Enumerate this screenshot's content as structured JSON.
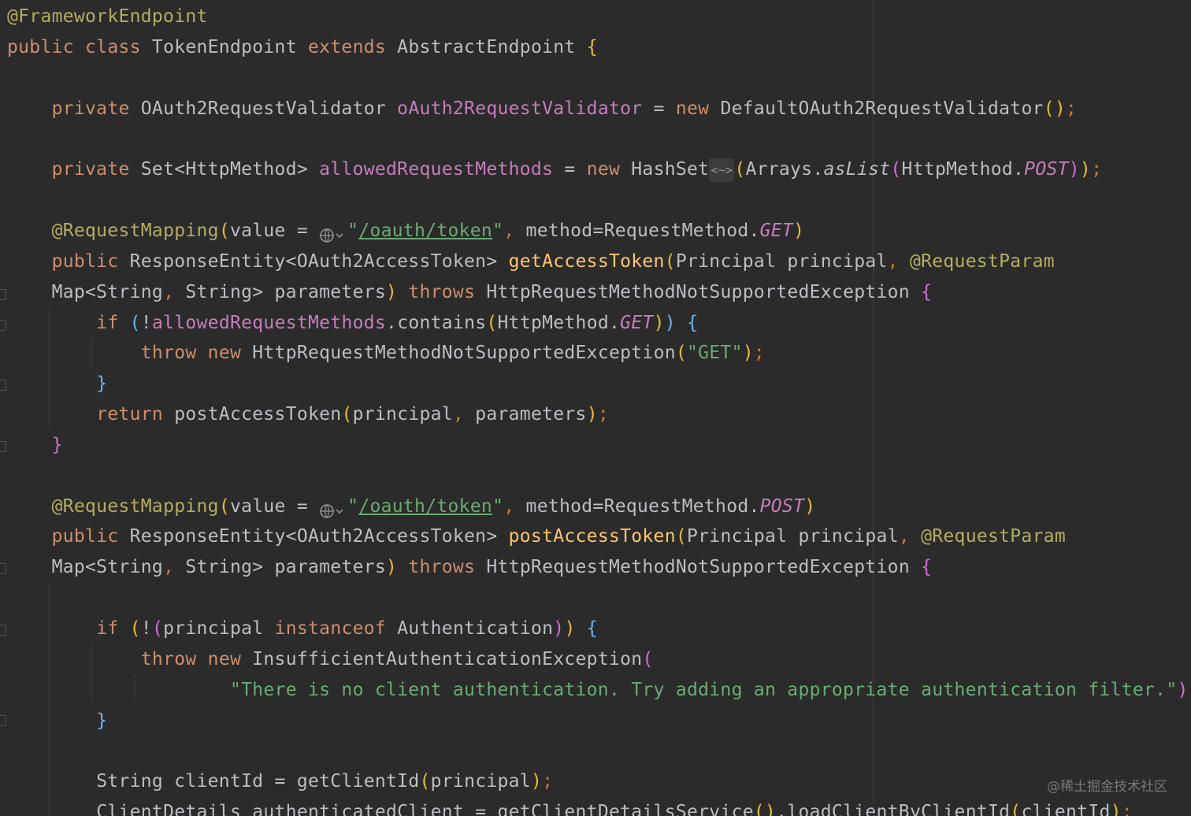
{
  "watermark": "@稀土掘金技术社区",
  "code_lines": [
    [
      {
        "t": "@FrameworkEndpoint",
        "c": "ann"
      }
    ],
    [
      {
        "t": "public ",
        "c": "kw"
      },
      {
        "t": "class ",
        "c": "kw"
      },
      {
        "t": "TokenEndpoint "
      },
      {
        "t": "extends ",
        "c": "kw"
      },
      {
        "t": "AbstractEndpoint "
      },
      {
        "t": "{",
        "c": "b1"
      }
    ],
    [],
    [
      {
        "t": "    "
      },
      {
        "t": "private ",
        "c": "kw"
      },
      {
        "t": "OAuth2RequestValidator "
      },
      {
        "t": "oAuth2RequestValidator",
        "c": "fld"
      },
      {
        "t": " = "
      },
      {
        "t": "new ",
        "c": "kw"
      },
      {
        "t": "DefaultOAuth2RequestValidator"
      },
      {
        "t": "()",
        "c": "b1"
      },
      {
        "t": ";",
        "c": "pun"
      }
    ],
    [],
    [
      {
        "t": "    "
      },
      {
        "t": "private ",
        "c": "kw"
      },
      {
        "t": "Set<HttpMethod> "
      },
      {
        "t": "allowedRequestMethods",
        "c": "fld"
      },
      {
        "t": " = "
      },
      {
        "t": "new ",
        "c": "kw"
      },
      {
        "t": "HashSet"
      },
      {
        "t": "<~>",
        "c": "hint"
      },
      {
        "t": "(",
        "c": "b1"
      },
      {
        "t": "Arrays."
      },
      {
        "t": "asList",
        "c": "it"
      },
      {
        "t": "(",
        "c": "b2"
      },
      {
        "t": "HttpMethod."
      },
      {
        "t": "POST",
        "c": "fld it"
      },
      {
        "t": ")",
        "c": "b2"
      },
      {
        "t": ")",
        "c": "b1"
      },
      {
        "t": ";",
        "c": "pun"
      }
    ],
    [],
    [
      {
        "t": "    "
      },
      {
        "t": "@RequestMapping",
        "c": "ann"
      },
      {
        "t": "(",
        "c": "b1"
      },
      {
        "t": "value = "
      },
      {
        "t": "",
        "c": "globe"
      },
      {
        "t": "\"",
        "c": "str"
      },
      {
        "t": "/oauth/token",
        "c": "str ul"
      },
      {
        "t": "\"",
        "c": "str"
      },
      {
        "t": ", ",
        "c": "pun"
      },
      {
        "t": "method=RequestMethod."
      },
      {
        "t": "GET",
        "c": "fld it"
      },
      {
        "t": ")",
        "c": "b1"
      }
    ],
    [
      {
        "t": "    "
      },
      {
        "t": "public ",
        "c": "kw"
      },
      {
        "t": "ResponseEntity<OAuth2AccessToken> "
      },
      {
        "t": "getAccessToken",
        "c": "mc"
      },
      {
        "t": "(",
        "c": "b1"
      },
      {
        "t": "Principal principal"
      },
      {
        "t": ", ",
        "c": "pun"
      },
      {
        "t": "@RequestParam",
        "c": "ann"
      }
    ],
    [
      {
        "t": "    "
      },
      {
        "t": "Map<String"
      },
      {
        "t": ", ",
        "c": "pun"
      },
      {
        "t": "String> parameters"
      },
      {
        "t": ")",
        "c": "b1"
      },
      {
        "t": " "
      },
      {
        "t": "throws ",
        "c": "kw"
      },
      {
        "t": "HttpRequestMethodNotSupportedException "
      },
      {
        "t": "{",
        "c": "b2"
      }
    ],
    [
      {
        "t": "        "
      },
      {
        "t": "if ",
        "c": "kw"
      },
      {
        "t": "(",
        "c": "b3"
      },
      {
        "t": "!"
      },
      {
        "t": "allowedRequestMethods",
        "c": "fld"
      },
      {
        "t": ".contains"
      },
      {
        "t": "(",
        "c": "b1"
      },
      {
        "t": "HttpMethod."
      },
      {
        "t": "GET",
        "c": "fld it"
      },
      {
        "t": ")",
        "c": "b1"
      },
      {
        "t": ")",
        "c": "b3"
      },
      {
        "t": " "
      },
      {
        "t": "{",
        "c": "b3"
      }
    ],
    [
      {
        "t": "            "
      },
      {
        "t": "throw ",
        "c": "kw"
      },
      {
        "t": "new ",
        "c": "kw"
      },
      {
        "t": "HttpRequestMethodNotSupportedException"
      },
      {
        "t": "(",
        "c": "b1"
      },
      {
        "t": "\"GET\"",
        "c": "str"
      },
      {
        "t": ")",
        "c": "b1"
      },
      {
        "t": ";",
        "c": "pun"
      }
    ],
    [
      {
        "t": "        "
      },
      {
        "t": "}",
        "c": "b3"
      }
    ],
    [
      {
        "t": "        "
      },
      {
        "t": "return ",
        "c": "kw"
      },
      {
        "t": "postAccessToken"
      },
      {
        "t": "(",
        "c": "b1"
      },
      {
        "t": "principal"
      },
      {
        "t": ", ",
        "c": "pun"
      },
      {
        "t": "parameters"
      },
      {
        "t": ")",
        "c": "b1"
      },
      {
        "t": ";",
        "c": "pun"
      }
    ],
    [
      {
        "t": "    "
      },
      {
        "t": "}",
        "c": "b2"
      }
    ],
    [],
    [
      {
        "t": "    "
      },
      {
        "t": "@RequestMapping",
        "c": "ann"
      },
      {
        "t": "(",
        "c": "b1"
      },
      {
        "t": "value = "
      },
      {
        "t": "",
        "c": "globe"
      },
      {
        "t": "\"",
        "c": "str"
      },
      {
        "t": "/oauth/token",
        "c": "str ul"
      },
      {
        "t": "\"",
        "c": "str"
      },
      {
        "t": ", ",
        "c": "pun"
      },
      {
        "t": "method=RequestMethod."
      },
      {
        "t": "POST",
        "c": "fld it"
      },
      {
        "t": ")",
        "c": "b1"
      }
    ],
    [
      {
        "t": "    "
      },
      {
        "t": "public ",
        "c": "kw"
      },
      {
        "t": "ResponseEntity<OAuth2AccessToken> "
      },
      {
        "t": "postAccessToken",
        "c": "mc"
      },
      {
        "t": "(",
        "c": "b1"
      },
      {
        "t": "Principal principal"
      },
      {
        "t": ", ",
        "c": "pun"
      },
      {
        "t": "@RequestParam",
        "c": "ann"
      }
    ],
    [
      {
        "t": "    "
      },
      {
        "t": "Map<String"
      },
      {
        "t": ", ",
        "c": "pun"
      },
      {
        "t": "String> parameters"
      },
      {
        "t": ")",
        "c": "b1"
      },
      {
        "t": " "
      },
      {
        "t": "throws ",
        "c": "kw"
      },
      {
        "t": "HttpRequestMethodNotSupportedException "
      },
      {
        "t": "{",
        "c": "b2"
      }
    ],
    [],
    [
      {
        "t": "        "
      },
      {
        "t": "if ",
        "c": "kw"
      },
      {
        "t": "(",
        "c": "b1"
      },
      {
        "t": "!"
      },
      {
        "t": "(",
        "c": "b2"
      },
      {
        "t": "principal "
      },
      {
        "t": "instanceof ",
        "c": "kw"
      },
      {
        "t": "Authentication"
      },
      {
        "t": ")",
        "c": "b2"
      },
      {
        "t": ")",
        "c": "b1"
      },
      {
        "t": " "
      },
      {
        "t": "{",
        "c": "b3"
      }
    ],
    [
      {
        "t": "            "
      },
      {
        "t": "throw ",
        "c": "kw"
      },
      {
        "t": "new ",
        "c": "kw"
      },
      {
        "t": "InsufficientAuthenticationException"
      },
      {
        "t": "(",
        "c": "b2"
      }
    ],
    [
      {
        "t": "                    "
      },
      {
        "t": "\"There is no client authentication. Try adding an appropriate authentication filter.\"",
        "c": "str"
      },
      {
        "t": ")",
        "c": "b2"
      },
      {
        "t": ";",
        "c": "pun"
      }
    ],
    [
      {
        "t": "        "
      },
      {
        "t": "}",
        "c": "b3"
      }
    ],
    [],
    [
      {
        "t": "        "
      },
      {
        "t": "String clientId = "
      },
      {
        "t": "getClientId"
      },
      {
        "t": "(",
        "c": "b1"
      },
      {
        "t": "principal"
      },
      {
        "t": ")",
        "c": "b1"
      },
      {
        "t": ";",
        "c": "pun"
      }
    ],
    [
      {
        "t": "        "
      },
      {
        "t": "ClientDetails authenticatedClient = "
      },
      {
        "t": "getClientDetailsService"
      },
      {
        "t": "()",
        "c": "b1"
      },
      {
        "t": ".loadClientByClientId"
      },
      {
        "t": "(",
        "c": "b1"
      },
      {
        "t": "clientId"
      },
      {
        "t": ")",
        "c": "b1"
      },
      {
        "t": ";",
        "c": "pun"
      }
    ]
  ]
}
